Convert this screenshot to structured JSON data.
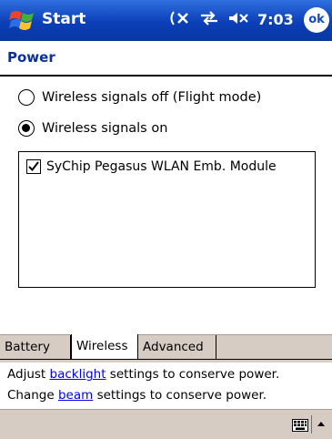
{
  "titlebar": {
    "start_label": "Start",
    "time": "7:03",
    "ok_label": "ok",
    "icons": [
      "connectivity-off-icon",
      "sync-icon",
      "volume-muted-icon"
    ]
  },
  "page": {
    "title": "Power"
  },
  "wireless": {
    "off_label": "Wireless signals off (Flight mode)",
    "on_label": "Wireless signals on",
    "selected": "on",
    "devices": [
      {
        "label": "SyChip Pegasus WLAN Emb. Module",
        "checked": true
      }
    ]
  },
  "tabs": [
    {
      "label": "Battery",
      "selected": false
    },
    {
      "label": "Wireless",
      "selected": true
    },
    {
      "label": "Advanced",
      "selected": false
    }
  ],
  "help": {
    "line1_prefix": "Adjust ",
    "line1_link": "backlight",
    "line1_suffix": " settings to conserve power.",
    "line2_prefix": "Change ",
    "line2_link": "beam",
    "line2_suffix": " settings to conserve power."
  },
  "menubar": {
    "icons": [
      "keyboard-icon",
      "input-menu-arrow-icon"
    ]
  },
  "colors": {
    "titlebar": "#0b3fb8",
    "title_text": "#0a2f9e",
    "tab_bg": "#d6ccc4",
    "link": "#0000ee"
  }
}
